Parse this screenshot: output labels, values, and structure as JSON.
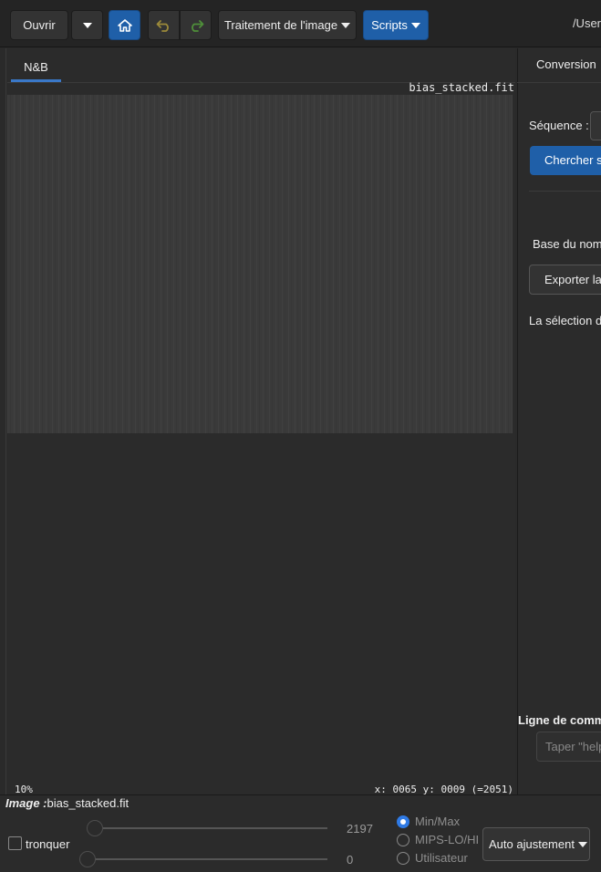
{
  "toolbar": {
    "open_label": "Ouvrir",
    "image_processing_label": "Traitement de l'image",
    "scripts_label": "Scripts",
    "path_text": "/User"
  },
  "viewer": {
    "tab_label": "N&B",
    "file_name": "bias_stacked.fit",
    "zoom": "10%",
    "coordinates": "x: 0065 y: 0009 (=2051)"
  },
  "side_panel": {
    "tab_label": "Conversion",
    "sequence_label": "Séquence :",
    "search_button_label": "Chercher se",
    "base_name_label": "Base du nom",
    "export_button_label": "Exporter la",
    "selection_text": "La sélection d'",
    "command_line_label": "Ligne de comma",
    "command_placeholder": "Taper \"help"
  },
  "bottom": {
    "image_label": "Image :",
    "image_name": "bias_stacked.fit",
    "truncate_label": "tronquer",
    "truncate_checked": false,
    "high_value": "2197",
    "low_value": "0",
    "modes": [
      {
        "label": "Min/Max",
        "selected": true
      },
      {
        "label": "MIPS-LO/HI",
        "selected": false
      },
      {
        "label": "Utilisateur",
        "selected": false
      }
    ],
    "auto_adjust_label": "Auto ajustement"
  },
  "colors": {
    "accent": "#1f5fa8",
    "background": "#2b2b2b",
    "toolbar": "#242424"
  }
}
